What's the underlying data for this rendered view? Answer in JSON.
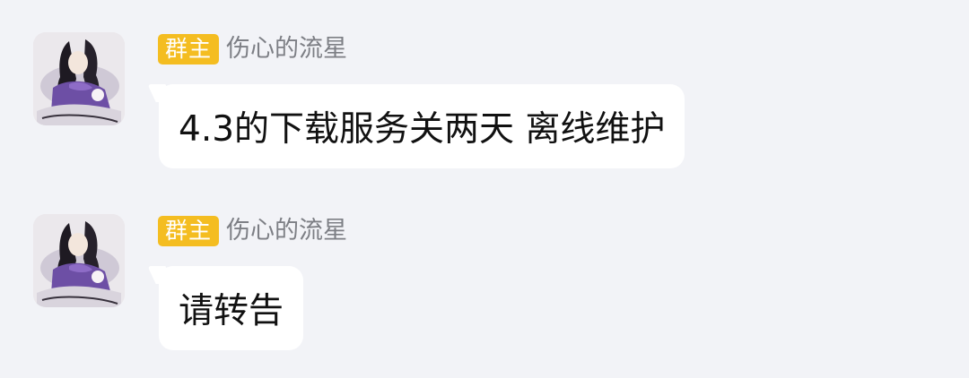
{
  "messages": [
    {
      "role_badge": "群主",
      "sender": "伤心的流星",
      "text": "4.3的下载服务关两天 离线维护"
    },
    {
      "role_badge": "群主",
      "sender": "伤心的流星",
      "text": "请转告"
    }
  ],
  "colors": {
    "background": "#f2f3f7",
    "badge": "#f4bd21",
    "bubble": "#ffffff",
    "sender_name": "#7d7f85"
  },
  "icons": {
    "avatar": "anime-character-avatar"
  }
}
